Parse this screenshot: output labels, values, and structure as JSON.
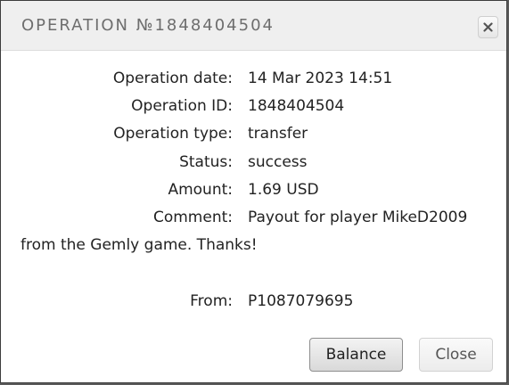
{
  "dialog": {
    "title": "OPERATION №1848404504",
    "close_icon": "close-x-icon"
  },
  "details": {
    "date_label": "Operation date:",
    "date_value": "14 Mar 2023 14:51",
    "id_label": "Operation ID:",
    "id_value": "1848404504",
    "type_label": "Operation type:",
    "type_value": "transfer",
    "status_label": "Status:",
    "status_value": "success",
    "amount_label": "Amount:",
    "amount_value": "1.69 USD",
    "comment_label": "Comment:",
    "comment_value_line1": "Payout for player MikeD2009",
    "comment_value_line2": "from the Gemly game. Thanks!",
    "from_label": "From:",
    "from_value": "P1087079695"
  },
  "buttons": {
    "balance_label": "Balance",
    "close_label": "Close"
  }
}
